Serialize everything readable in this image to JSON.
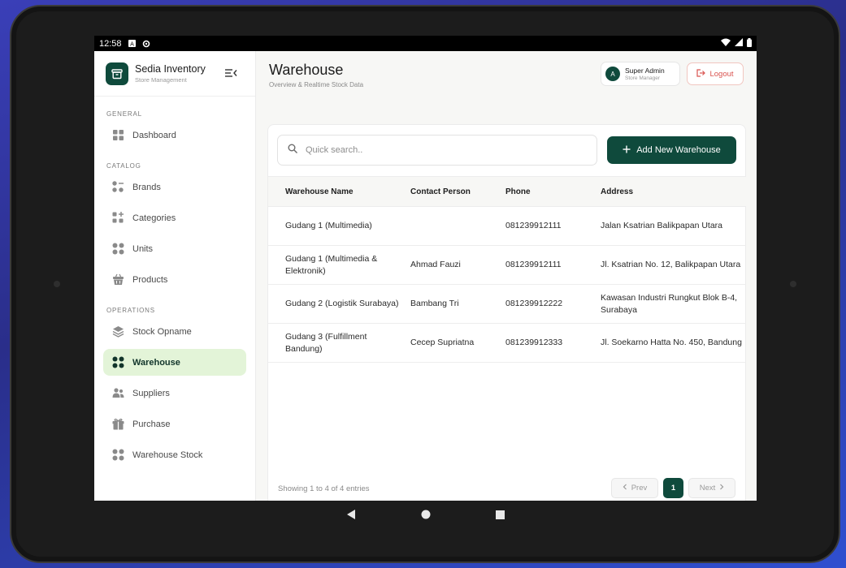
{
  "status_bar": {
    "time": "12:58"
  },
  "brand": {
    "name": "Sedia Inventory",
    "tagline": "Store Management"
  },
  "sidebar": {
    "sections": [
      {
        "title": "GENERAL",
        "items": [
          {
            "label": "Dashboard",
            "icon": "grid-icon"
          }
        ]
      },
      {
        "title": "CATALOG",
        "items": [
          {
            "label": "Brands",
            "icon": "grid-minus-icon"
          },
          {
            "label": "Categories",
            "icon": "grid-plus-icon"
          },
          {
            "label": "Units",
            "icon": "grid-icon"
          },
          {
            "label": "Products",
            "icon": "basket-icon"
          }
        ]
      },
      {
        "title": "OPERATIONS",
        "items": [
          {
            "label": "Stock Opname",
            "icon": "layers-icon"
          },
          {
            "label": "Warehouse",
            "icon": "grid-icon",
            "active": true
          },
          {
            "label": "Suppliers",
            "icon": "users-icon"
          },
          {
            "label": "Purchase",
            "icon": "gift-icon"
          },
          {
            "label": "Warehouse Stock",
            "icon": "grid-icon"
          }
        ]
      }
    ]
  },
  "header": {
    "title": "Warehouse",
    "subtitle": "Overview & Realtime Stock Data",
    "user": {
      "initial": "A",
      "name": "Super Admin",
      "role": "Store Manager"
    },
    "logout_label": "Logout"
  },
  "toolbar": {
    "search_placeholder": "Quick search..",
    "add_label": "Add New Warehouse"
  },
  "table": {
    "columns": [
      "Warehouse Name",
      "Contact Person",
      "Phone",
      "Address"
    ],
    "rows": [
      [
        "Gudang 1 (Multimedia)",
        "",
        "081239912111",
        "Jalan Ksatrian Balikpapan Utara"
      ],
      [
        "Gudang 1 (Multimedia & Elektronik)",
        "Ahmad Fauzi",
        "081239912111",
        "Jl. Ksatrian No. 12, Balikpapan Utara"
      ],
      [
        "Gudang 2 (Logistik Surabaya)",
        "Bambang Tri",
        "081239912222",
        "Kawasan Industri Rungkut Blok B-4, Surabaya"
      ],
      [
        "Gudang 3 (Fulfillment Bandung)",
        "Cecep Supriatna",
        "081239912333",
        "Jl. Soekarno Hatta No. 450, Bandung"
      ]
    ]
  },
  "pagination": {
    "info": "Showing 1 to 4 of 4 entries",
    "prev_label": "Prev",
    "next_label": "Next",
    "current_page": "1"
  },
  "colors": {
    "brand": "#0f4a3c",
    "active_bg": "#e3f4d8",
    "danger": "#d9534f"
  }
}
